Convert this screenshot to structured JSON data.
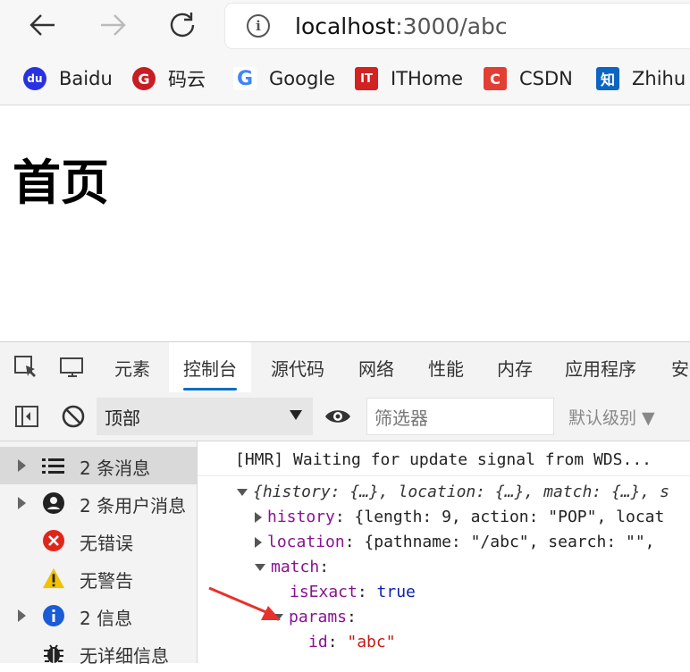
{
  "browser": {
    "url_host": "localhost",
    "url_path": ":3000/abc"
  },
  "bookmarks": [
    {
      "label": "Baidu",
      "icon": "baidu-icon",
      "color": "#2932e1"
    },
    {
      "label": "码云",
      "icon": "gitee-icon",
      "color": "#c71d23"
    },
    {
      "label": "Google",
      "icon": "google-icon",
      "color": "#4285f4"
    },
    {
      "label": "ITHome",
      "icon": "ithome-icon",
      "color": "#d22222"
    },
    {
      "label": "CSDN",
      "icon": "csdn-icon",
      "color": "#e33e33"
    },
    {
      "label": "Zhihu",
      "icon": "zhihu-icon",
      "color": "#0a66c2"
    }
  ],
  "page": {
    "heading": "首页"
  },
  "devtools": {
    "tabs": [
      "元素",
      "控制台",
      "源代码",
      "网络",
      "性能",
      "内存",
      "应用程序",
      "安"
    ],
    "active_tab": "控制台",
    "context": "顶部",
    "filter_placeholder": "筛选器",
    "level": "默认级别 ▼",
    "sidebar": [
      {
        "label": "2 条消息",
        "icon": "list-icon"
      },
      {
        "label": "2 条用户消息",
        "icon": "user-icon"
      },
      {
        "label": "无错误",
        "icon": "error-icon"
      },
      {
        "label": "无警告",
        "icon": "warning-icon"
      },
      {
        "label": "2 信息",
        "icon": "info-icon"
      },
      {
        "label": "无详细信息",
        "icon": "bug-icon"
      }
    ],
    "console": {
      "hmr_line": "[HMR] Waiting for update signal from WDS...",
      "obj_summary": "{history: {…}, location: {…}, match: {…}, s",
      "history_key": "history",
      "history_val": "{length: 9, action: \"POP\", locat",
      "location_key": "location",
      "location_val": "{pathname: \"/abc\", search: \"\",",
      "match_key": "match",
      "isExact_key": "isExact",
      "isExact_val": "true",
      "params_key": "params",
      "id_key": "id",
      "id_val": "\"abc\""
    }
  },
  "colors": {
    "accent": "#0a6fc2",
    "annotation_arrow": "#e8312a"
  }
}
